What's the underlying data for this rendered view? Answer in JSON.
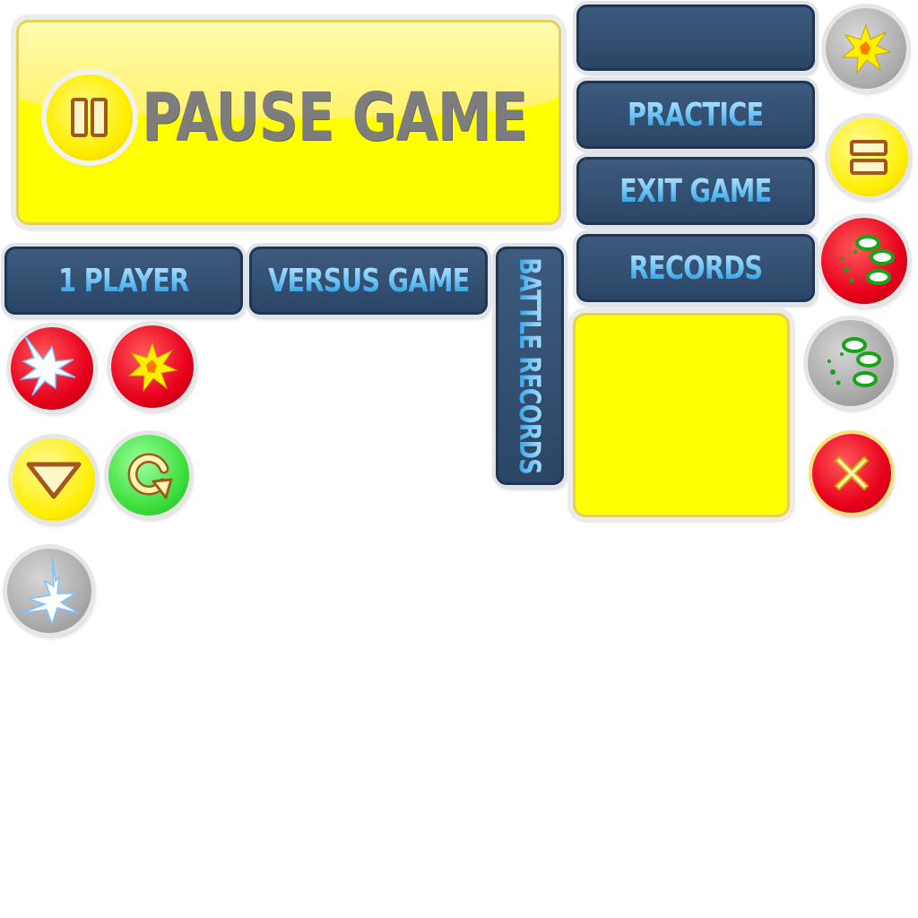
{
  "pause_panel": {
    "title": "PAUSE GAME"
  },
  "buttons": {
    "practice": "PRACTICE",
    "exit_game": "EXIT GAME",
    "records": "RECORDS",
    "one_player": "1 PLAYER",
    "versus_game": "VERSUS GAME",
    "battle_records": "BATTLE RECORDS"
  },
  "icons": [
    "burst-icon-gray",
    "pause-icon-yellow",
    "splash-icon-red",
    "splash-icon-gray",
    "close-icon",
    "lightning-icon-red",
    "burst-icon-red",
    "dropdown-icon",
    "refresh-icon",
    "lightning-icon-gray"
  ],
  "colors": {
    "panel_yellow": "#ffff00",
    "button_navy": "#2f4b6e",
    "button_text": "#6cc4f5",
    "title_gray": "#7d7d7d",
    "red": "#e8001c",
    "green": "#3fe03f"
  }
}
